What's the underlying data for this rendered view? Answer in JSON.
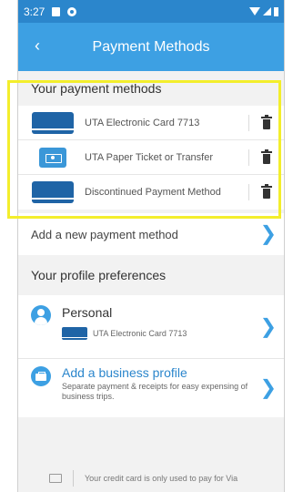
{
  "status_bar": {
    "time": "3:27"
  },
  "app_bar": {
    "back_icon": "chevron-left-icon",
    "title": "Payment Methods"
  },
  "payment_methods": {
    "header": "Your payment methods",
    "items": [
      {
        "label": "UTA Electronic Card 7713",
        "icon": "card-icon"
      },
      {
        "label": "UTA Paper Ticket or Transfer",
        "icon": "ticket-icon"
      },
      {
        "label": "Discontinued Payment Method",
        "icon": "card-icon"
      }
    ],
    "add_label": "Add a new payment method"
  },
  "profile": {
    "header": "Your profile preferences",
    "personal": {
      "name": "Personal",
      "card_label": "UTA Electronic Card 7713"
    },
    "business": {
      "title": "Add a business profile",
      "description": "Separate payment & receipts for easy expensing of business trips."
    }
  },
  "footer": {
    "text": "Your credit card is only used to pay for Via"
  },
  "colors": {
    "primary": "#3da0e3",
    "status_bar": "#2b86cc",
    "card": "#1f64a6",
    "highlight": "#f3ee2c"
  }
}
